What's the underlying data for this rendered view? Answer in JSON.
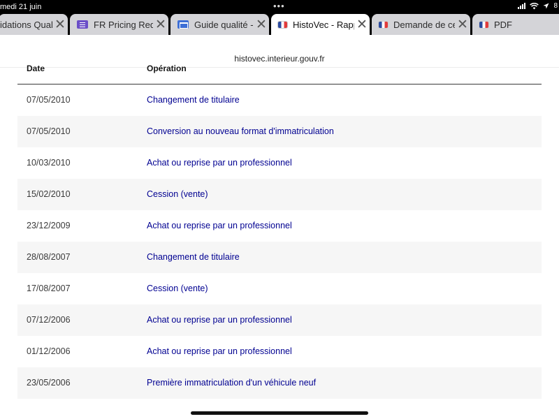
{
  "status_bar": {
    "date": "medi 21 juin",
    "dots": "•••",
    "battery": "8"
  },
  "tabs": [
    {
      "label": "idations Quali",
      "favicon": "none",
      "active": false
    },
    {
      "label": "FR Pricing Reque",
      "favicon": "form-icon",
      "active": false
    },
    {
      "label": "Guide qualité - C",
      "favicon": "doc-icon",
      "active": false
    },
    {
      "label": "HistoVec - Rappo",
      "favicon": "flag-icon",
      "active": true
    },
    {
      "label": "Demande de cer",
      "favicon": "flag-icon",
      "active": false
    },
    {
      "label": "PDF",
      "favicon": "flag-icon",
      "active": false
    }
  ],
  "url": "histovec.interieur.gouv.fr",
  "table": {
    "headers": {
      "date": "Date",
      "operation": "Opération"
    },
    "rows": [
      {
        "date": "07/05/2010",
        "operation": "Changement de titulaire"
      },
      {
        "date": "07/05/2010",
        "operation": "Conversion au nouveau format d'immatriculation"
      },
      {
        "date": "10/03/2010",
        "operation": "Achat ou reprise par un professionnel"
      },
      {
        "date": "15/02/2010",
        "operation": "Cession (vente)"
      },
      {
        "date": "23/12/2009",
        "operation": "Achat ou reprise par un professionnel"
      },
      {
        "date": "28/08/2007",
        "operation": "Changement de titulaire"
      },
      {
        "date": "17/08/2007",
        "operation": "Cession (vente)"
      },
      {
        "date": "07/12/2006",
        "operation": "Achat ou reprise par un professionnel"
      },
      {
        "date": "01/12/2006",
        "operation": "Achat ou reprise par un professionnel"
      },
      {
        "date": "23/05/2006",
        "operation": "Première immatriculation d'un véhicule neuf"
      }
    ]
  },
  "colors": {
    "link": "#000091",
    "row_alt": "#f6f6f6",
    "tab_inactive": "#d4d4d8"
  }
}
